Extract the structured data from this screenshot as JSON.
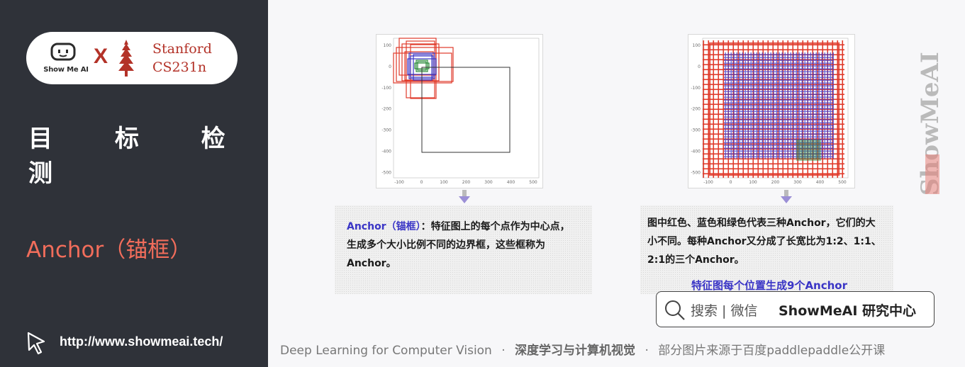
{
  "sidebar": {
    "logo": {
      "brand": "Show Me AI",
      "x": "X",
      "stanford_line1": "Stanford",
      "stanford_line2": "CS231n"
    },
    "title": "目 标 检 测",
    "subtitle": "Anchor（锚框）",
    "url": "http://www.showmeai.tech/"
  },
  "left_plot": {
    "yticks": [
      "100",
      "0",
      "-100",
      "-200",
      "-300",
      "-400",
      "-500"
    ],
    "xticks": [
      "-100",
      "0",
      "100",
      "200",
      "300",
      "400",
      "500"
    ]
  },
  "right_plot": {
    "yticks": [
      "100",
      "0",
      "-100",
      "-200",
      "-300",
      "-400",
      "-500"
    ],
    "xticks": [
      "-100",
      "0",
      "100",
      "200",
      "300",
      "400",
      "500"
    ]
  },
  "left_text": {
    "term": "Anchor（锚框）",
    "line1_rest": "：特征图上的每个点作为中心点，",
    "line2": "生成多个大小比例不同的边界框，这些框称为",
    "line3": "Anchor。"
  },
  "right_text": {
    "line1": "图中红色、蓝色和绿色代表三种Anchor，它们的大",
    "line2": "小不同。每种Anchor又分成了长宽比为1:2、1:1、",
    "line3": "2:1的三个Anchor。",
    "highlight": "特征图每个位置生成9个Anchor"
  },
  "search": {
    "text": "搜索 | 微信",
    "brand": "ShowMeAI 研究中心"
  },
  "watermark": "ShowMeAI",
  "footer": {
    "part1": "Deep Learning for Computer Vision",
    "sep": "·",
    "part2": "深度学习与计算机视觉",
    "part3": "部分图片来源于百度paddlepaddle公开课"
  },
  "colors": {
    "sidebar_bg": "#2f3239",
    "accent_red": "#f26d5b",
    "anchor_red": "#e03a2a",
    "anchor_blue": "#3a35c6",
    "anchor_green": "#2a8a3a"
  }
}
